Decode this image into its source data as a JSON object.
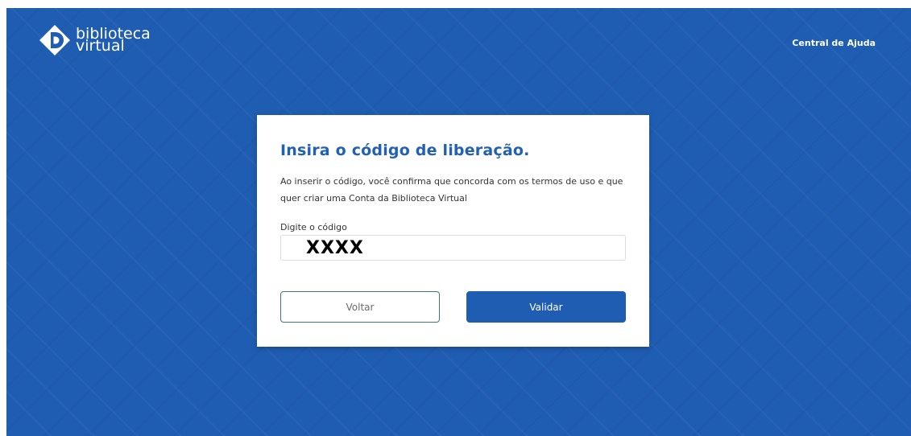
{
  "header": {
    "logo_line1": "biblioteca",
    "logo_line2": "virtual",
    "help_link": "Central de Ajuda"
  },
  "card": {
    "title": "Insira o código de liberação.",
    "description": "Ao inserir o código, você confirma que concorda com os termos de uso e que quer criar uma Conta da Biblioteca Virtual",
    "field_label": "Digite o código",
    "code_value": "XXXX",
    "back_label": "Voltar",
    "validate_label": "Validar"
  },
  "colors": {
    "background": "#1f5db3",
    "title": "#2160b2",
    "primary_button": "#1f5db3",
    "back_button_border": "#3d7a6f"
  }
}
